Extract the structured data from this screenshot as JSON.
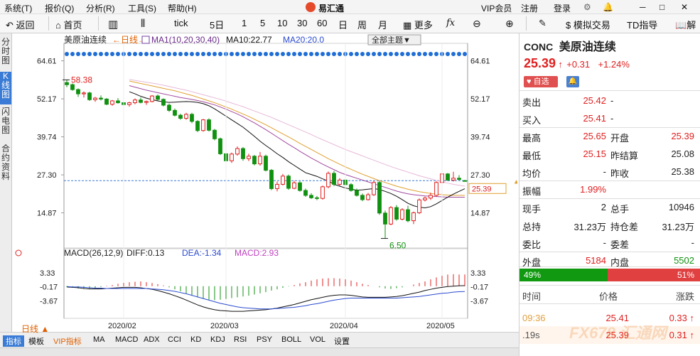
{
  "menu": [
    "系统(T)",
    "报价(Q)",
    "分析(R)",
    "工具(S)",
    "帮助(H)"
  ],
  "app_title": "易汇通",
  "vip_label": "VIP会员",
  "register_label": "注册",
  "login_label": "登录",
  "window_controls": [
    "─",
    "□",
    "✕"
  ],
  "toolbar": {
    "back": "返回",
    "home": "首页",
    "tick": "tick",
    "periods": [
      "5日",
      "1",
      "5",
      "10",
      "30",
      "60",
      "日",
      "周",
      "月"
    ],
    "more": "更多",
    "fx": "fx",
    "sim_trade": "模拟交易",
    "td_indicator": "TD指导",
    "explain": "解"
  },
  "leftnav": {
    "fenshi": "分时图",
    "kline": "K线图",
    "flash": "闪电图",
    "contract": "合约资料"
  },
  "chart_header": {
    "name": "美原油连续",
    "period": "←日线→",
    "ma_label": "MA1(10,20,30,40)",
    "ma10": "MA10:22.77",
    "ma20": "MA20:20.0",
    "theme": "全部主题▼"
  },
  "macd_header": {
    "label": "MACD(26,12,9)",
    "diff": "DIFF:0.13",
    "dea": "DEA:-1.34",
    "macd": "MACD:2.93"
  },
  "bottom_tabs": [
    "指标",
    "模板",
    "VIP指标",
    "MA",
    "MACD",
    "ADX",
    "CCI",
    "KD",
    "KDJ",
    "RSI",
    "PSY",
    "BOLL",
    "VOL",
    "设置"
  ],
  "period_indicator": "日线 ▲",
  "colors": {
    "up": "#e02020",
    "down": "#109010",
    "ma10": "#111111",
    "ma20": "#a24aa0",
    "ma30": "#e0a030",
    "ma40": "#e6b8d8",
    "macd_pos": "#e02020",
    "macd_neg": "#109010",
    "accent": "#3a7bd5"
  },
  "chart_data": {
    "type": "candlestick",
    "price_axis_ticks": [
      "64.61",
      "52.17",
      "39.74",
      "27.30",
      "14.87"
    ],
    "price_ylim": [
      5,
      68
    ],
    "macd_axis_ticks": [
      "3.33",
      "-0.17",
      "-3.67"
    ],
    "macd_ylim": [
      -7,
      6
    ],
    "x_tick_labels": [
      "2020/02",
      "2020/03",
      "2020/04",
      "2020/05"
    ],
    "high_label": "58.38",
    "low_label": "6.50",
    "last_price_tag": "25.39",
    "current_price": 25.39,
    "candles": [
      [
        57.5,
        58.4,
        56.0,
        56.8
      ],
      [
        56.8,
        57.2,
        54.8,
        55.2
      ],
      [
        55.2,
        55.6,
        52.8,
        53.8
      ],
      [
        53.8,
        54.6,
        52.6,
        54.1
      ],
      [
        54.1,
        54.5,
        51.5,
        51.9
      ],
      [
        51.9,
        52.8,
        51.2,
        52.4
      ],
      [
        52.4,
        53.3,
        51.6,
        52.1
      ],
      [
        52.1,
        52.4,
        50.1,
        50.4
      ],
      [
        50.4,
        51.8,
        49.9,
        51.5
      ],
      [
        51.5,
        52.4,
        50.6,
        50.9
      ],
      [
        50.9,
        51.2,
        49.8,
        50.3
      ],
      [
        50.3,
        51.2,
        49.6,
        50.9
      ],
      [
        50.9,
        52.3,
        50.4,
        51.8
      ],
      [
        51.8,
        52.6,
        50.7,
        51.0
      ],
      [
        51.0,
        51.6,
        50.2,
        51.3
      ],
      [
        51.3,
        53.4,
        51.0,
        53.1
      ],
      [
        53.1,
        53.6,
        51.6,
        52.0
      ],
      [
        52.0,
        52.3,
        49.7,
        50.1
      ],
      [
        50.1,
        50.6,
        47.9,
        48.4
      ],
      [
        48.4,
        49.0,
        46.4,
        46.8
      ],
      [
        46.8,
        47.3,
        45.3,
        45.8
      ],
      [
        45.8,
        47.6,
        45.3,
        47.1
      ],
      [
        47.1,
        47.6,
        44.2,
        44.8
      ],
      [
        44.8,
        45.2,
        41.3,
        41.8
      ],
      [
        41.8,
        45.6,
        41.4,
        45.3
      ],
      [
        45.3,
        45.8,
        41.5,
        41.9
      ],
      [
        41.9,
        42.3,
        38.6,
        39.1
      ],
      [
        39.1,
        39.5,
        33.8,
        34.2
      ],
      [
        34.2,
        35.0,
        31.4,
        31.9
      ],
      [
        31.9,
        34.6,
        31.2,
        34.1
      ],
      [
        34.1,
        36.6,
        33.6,
        35.9
      ],
      [
        35.9,
        36.4,
        31.9,
        32.6
      ],
      [
        32.6,
        34.2,
        31.8,
        33.4
      ],
      [
        33.4,
        33.8,
        30.4,
        30.9
      ],
      [
        30.9,
        34.8,
        30.3,
        33.4
      ],
      [
        33.4,
        33.9,
        28.4,
        28.8
      ],
      [
        28.8,
        29.2,
        22.3,
        22.8
      ],
      [
        22.8,
        25.1,
        21.9,
        24.2
      ],
      [
        24.2,
        27.6,
        23.8,
        26.9
      ],
      [
        26.9,
        27.4,
        22.4,
        22.9
      ],
      [
        22.9,
        25.3,
        22.6,
        24.7
      ],
      [
        24.7,
        25.2,
        21.8,
        22.2
      ],
      [
        22.2,
        22.8,
        20.1,
        20.6
      ],
      [
        20.6,
        21.3,
        19.4,
        19.8
      ],
      [
        19.8,
        20.4,
        19.0,
        19.6
      ],
      [
        19.6,
        23.8,
        19.2,
        23.4
      ],
      [
        23.4,
        28.4,
        22.9,
        27.8
      ],
      [
        27.8,
        28.6,
        23.6,
        24.2
      ],
      [
        24.2,
        26.2,
        23.7,
        25.6
      ],
      [
        25.6,
        26.0,
        23.4,
        24.1
      ],
      [
        24.1,
        24.6,
        21.8,
        22.2
      ],
      [
        22.2,
        22.8,
        20.2,
        20.6
      ],
      [
        20.6,
        21.2,
        18.7,
        19.2
      ],
      [
        19.2,
        21.4,
        18.9,
        20.8
      ],
      [
        20.8,
        25.3,
        20.4,
        24.8
      ],
      [
        24.8,
        25.3,
        14.2,
        14.8
      ],
      [
        14.8,
        15.6,
        6.5,
        11.2
      ],
      [
        11.2,
        17.1,
        10.8,
        16.6
      ],
      [
        16.6,
        17.4,
        12.3,
        12.8
      ],
      [
        12.8,
        16.4,
        12.4,
        15.9
      ],
      [
        15.9,
        17.2,
        11.8,
        12.3
      ],
      [
        12.3,
        15.3,
        11.2,
        14.9
      ],
      [
        14.9,
        19.6,
        14.5,
        19.1
      ],
      [
        19.1,
        20.2,
        18.6,
        19.7
      ],
      [
        19.7,
        21.5,
        19.1,
        20.6
      ],
      [
        20.6,
        25.2,
        20.2,
        24.8
      ],
      [
        24.8,
        28.2,
        24.4,
        27.6
      ],
      [
        27.6,
        27.9,
        25.3,
        25.6
      ],
      [
        25.6,
        28.3,
        25.1,
        26.2
      ],
      [
        26.2,
        27.2,
        25.4,
        25.8
      ],
      [
        25.4,
        25.65,
        25.15,
        25.39
      ]
    ],
    "ma10": [
      54.5,
      53.8,
      53.0,
      52.4,
      51.9,
      51.5,
      51.2,
      51.0,
      51.1,
      51.2,
      51.3,
      51.2,
      51.0,
      50.6,
      49.9,
      48.9,
      47.7,
      46.5,
      45.3,
      44.1,
      42.9,
      41.4,
      39.9,
      38.3,
      36.9,
      35.6,
      34.2,
      33.0,
      31.6,
      30.4,
      29.2,
      28.0,
      27.4,
      26.8,
      26.0,
      25.3,
      24.2,
      23.6,
      23.0,
      22.6,
      22.3,
      22.4,
      22.6,
      22.8,
      22.5,
      21.9,
      21.2,
      20.3,
      19.2,
      18.0,
      17.2,
      16.7,
      16.5,
      16.9,
      17.8,
      18.9,
      20.0,
      21.0,
      21.9,
      22.77
    ],
    "ma20": [
      56.5,
      56.0,
      55.5,
      55.0,
      54.6,
      54.2,
      53.8,
      53.4,
      53.0,
      52.6,
      52.3,
      52.0,
      51.6,
      51.2,
      50.7,
      50.2,
      49.5,
      48.8,
      48.0,
      47.2,
      46.3,
      45.3,
      44.3,
      43.2,
      42.1,
      40.9,
      39.7,
      38.5,
      37.3,
      36.2,
      35.0,
      33.9,
      32.8,
      31.8,
      30.8,
      29.9,
      29.0,
      28.1,
      27.4,
      26.8,
      26.2,
      25.6,
      25.0,
      24.4,
      23.8,
      23.2,
      22.6,
      22.0,
      21.5,
      21.1,
      20.8,
      20.6,
      20.4,
      20.3,
      20.2,
      20.1,
      20.0,
      20.0,
      20.0,
      20.0
    ],
    "ma30": [
      58.0,
      57.6,
      57.2,
      56.8,
      56.4,
      56.0,
      55.6,
      55.2,
      54.8,
      54.3,
      53.8,
      53.3,
      52.7,
      52.1,
      51.5,
      50.9,
      50.2,
      49.5,
      48.8,
      48.0,
      47.2,
      46.4,
      45.5,
      44.6,
      43.7,
      42.7,
      41.7,
      40.7,
      39.7,
      38.7,
      37.6,
      36.6,
      35.6,
      34.6,
      33.6,
      32.6,
      31.7,
      30.8,
      29.9,
      29.1,
      28.3,
      27.5,
      26.8,
      26.1,
      25.4,
      24.8,
      24.2,
      23.6,
      23.1,
      22.6,
      22.2,
      21.8,
      21.5,
      21.2,
      21.0,
      20.8,
      20.7,
      20.6,
      20.6,
      20.6
    ],
    "ma40": [
      58.5,
      58.2,
      57.9,
      57.6,
      57.3,
      57.0,
      56.6,
      56.2,
      55.8,
      55.4,
      55.0,
      54.5,
      54.0,
      53.5,
      53.0,
      52.5,
      52.0,
      51.4,
      50.8,
      50.2,
      49.6,
      48.9,
      48.2,
      47.5,
      46.8,
      46.1,
      45.3,
      44.5,
      43.7,
      42.9,
      42.1,
      41.3,
      40.5,
      39.6,
      38.8,
      38.0,
      37.2,
      36.4,
      35.6,
      34.9,
      34.2,
      33.5,
      32.8,
      32.1,
      31.4,
      30.7,
      30.0,
      29.4,
      28.8,
      28.2,
      27.6,
      27.0,
      26.5,
      26.0,
      25.5,
      25.0,
      24.6,
      24.2,
      23.9,
      23.6
    ],
    "macd_hist": [
      -0.2,
      -0.4,
      -0.6,
      -0.7,
      -0.6,
      -0.4,
      -0.2,
      0.1,
      0.3,
      0.6,
      0.8,
      1.0,
      1.1,
      1.2,
      1.0,
      0.8,
      0.5,
      0.2,
      -0.3,
      -0.8,
      -1.3,
      -1.8,
      -2.3,
      -2.8,
      -3.2,
      -3.4,
      -3.5,
      -3.4,
      -3.2,
      -3.0,
      -2.8,
      -2.6,
      -2.4,
      -2.1,
      -1.8,
      -1.5,
      -1.1,
      -0.8,
      -0.4,
      -0.1,
      0.3,
      0.7,
      1.0,
      1.4,
      1.7,
      1.9,
      2.0,
      2.0,
      1.9,
      1.7,
      1.4,
      1.0,
      0.6,
      0.3,
      0.0,
      -0.3,
      -0.6,
      -0.7,
      -0.5,
      -0.3,
      0.0,
      0.4,
      0.8,
      1.2,
      1.7,
      2.2,
      2.6,
      2.9,
      3.0,
      2.9,
      2.93
    ],
    "macd_diff": [
      -0.2,
      -0.3,
      -0.4,
      -0.6,
      -0.7,
      -0.7,
      -0.7,
      -0.6,
      -0.5,
      -0.4,
      -0.3,
      -0.3,
      -0.3,
      -0.4,
      -0.6,
      -0.8,
      -1.1,
      -1.5,
      -1.9,
      -2.4,
      -2.9,
      -3.5,
      -4.1,
      -4.7,
      -5.2,
      -5.6,
      -5.9,
      -6.1,
      -6.2,
      -6.3,
      -6.3,
      -6.3,
      -6.2,
      -6.1,
      -6.0,
      -5.9,
      -5.7,
      -5.5,
      -5.2,
      -4.9,
      -4.6,
      -4.2,
      -3.8,
      -3.4,
      -3.1,
      -2.8,
      -2.5,
      -2.3,
      -2.2,
      -2.2,
      -2.3,
      -2.5,
      -2.7,
      -2.8,
      -2.8,
      -2.8,
      -2.8,
      -2.7,
      -2.6,
      -2.4,
      -2.1,
      -1.8,
      -1.5,
      -1.1,
      -0.8,
      -0.5,
      -0.3,
      -0.1,
      0.0,
      0.1,
      0.13
    ],
    "macd_dea": [
      -0.1,
      -0.2,
      -0.2,
      -0.3,
      -0.4,
      -0.5,
      -0.5,
      -0.6,
      -0.6,
      -0.6,
      -0.6,
      -0.6,
      -0.6,
      -0.6,
      -0.6,
      -0.7,
      -0.8,
      -0.9,
      -1.1,
      -1.3,
      -1.6,
      -1.9,
      -2.3,
      -2.7,
      -3.1,
      -3.5,
      -3.9,
      -4.3,
      -4.6,
      -4.9,
      -5.2,
      -5.4,
      -5.5,
      -5.6,
      -5.7,
      -5.7,
      -5.7,
      -5.6,
      -5.5,
      -5.4,
      -5.3,
      -5.1,
      -4.9,
      -4.6,
      -4.4,
      -4.1,
      -3.8,
      -3.5,
      -3.3,
      -3.1,
      -3.0,
      -3.0,
      -3.0,
      -3.0,
      -3.0,
      -3.0,
      -3.0,
      -3.0,
      -3.0,
      -2.9,
      -2.8,
      -2.7,
      -2.6,
      -2.4,
      -2.2,
      -2.0,
      -1.8,
      -1.7,
      -1.5,
      -1.4,
      -1.34
    ]
  },
  "quote": {
    "code": "CONC",
    "name": "美原油连续",
    "price": "25.39",
    "change": "+0.31",
    "change_pct": "+1.24%",
    "watch_btn": "自选",
    "rows": [
      {
        "l1": "卖出",
        "v1": "25.42",
        "l2": "-",
        "v2": ""
      },
      {
        "l1": "买入",
        "v1": "25.41",
        "l2": "-",
        "v2": ""
      },
      {
        "l1": "最高",
        "v1": "25.65",
        "l2": "开盘",
        "v2": "25.39"
      },
      {
        "l1": "最低",
        "v1": "25.15",
        "l2": "昨结算",
        "v2": "25.08"
      },
      {
        "l1": "均价",
        "v1": "-",
        "l2": "昨收",
        "v2": "25.38"
      },
      {
        "l1": "振幅",
        "v1": "1.99%",
        "l2": "",
        "v2": ""
      },
      {
        "l1": "现手",
        "v1": "2",
        "l2": "总手",
        "v2": "10946"
      },
      {
        "l1": "总持",
        "v1": "31.23万",
        "l2": "持仓差",
        "v2": "31.23万"
      },
      {
        "l1": "委比",
        "v1": "-",
        "l2": "委差",
        "v2": "-"
      },
      {
        "l1": "外盘",
        "v1": "5184",
        "l2": "内盘",
        "v2": "5502"
      }
    ],
    "buy_pct": "49%",
    "sell_pct": "51%",
    "buy_fraction": 0.49,
    "trade_headers": [
      "时间",
      "价格",
      "涨跌"
    ],
    "trades": [
      {
        "time": "09:36",
        "price": "25.41",
        "chg": "0.33"
      },
      {
        "time": ".19s",
        "price": "25.39",
        "chg": "0.31"
      }
    ],
    "watermark": "FX678 汇通网"
  }
}
